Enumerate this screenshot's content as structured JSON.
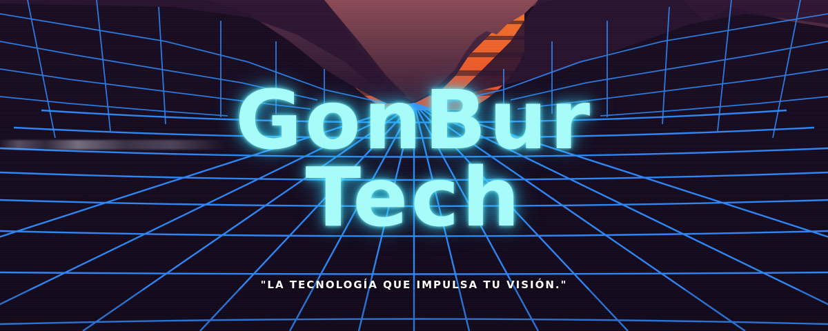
{
  "brand": {
    "line1": "GonBur",
    "line2": "Tech",
    "tagline": "\"LA TECNOLOGÍA QUE IMPULSA TU VISIÓN.\""
  },
  "colors": {
    "title_glow": "#a7fbf8",
    "grid_line": "#2f8cff",
    "sun_top": "#f39b2c",
    "sun_bottom": "#e8452a",
    "mountain": "#6a3a4a",
    "background": "#120a1c"
  }
}
